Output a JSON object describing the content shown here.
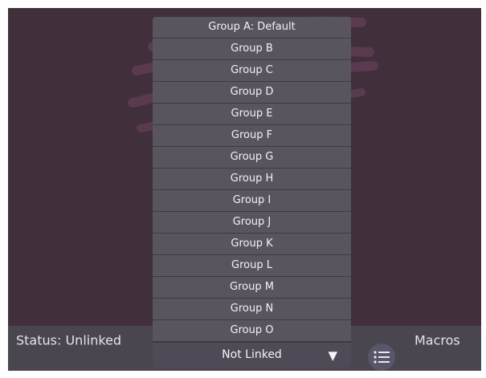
{
  "dropdown": {
    "options": [
      "Group A: Default",
      "Group B",
      "Group C",
      "Group D",
      "Group E",
      "Group F",
      "Group G",
      "Group H",
      "Group I",
      "Group J",
      "Group K",
      "Group L",
      "Group M",
      "Group N",
      "Group O"
    ],
    "selected": "Not Linked",
    "arrow_icon": "triangle-down-icon"
  },
  "status_bar": {
    "status_text": "Status: Unlinked",
    "macros_label": "Macros",
    "macros_icon": "list-icon"
  },
  "colors": {
    "background": "#412f3b",
    "bottom_bar": "#4a4650",
    "dropdown": "#58555f",
    "text": "#f2f2f4"
  }
}
